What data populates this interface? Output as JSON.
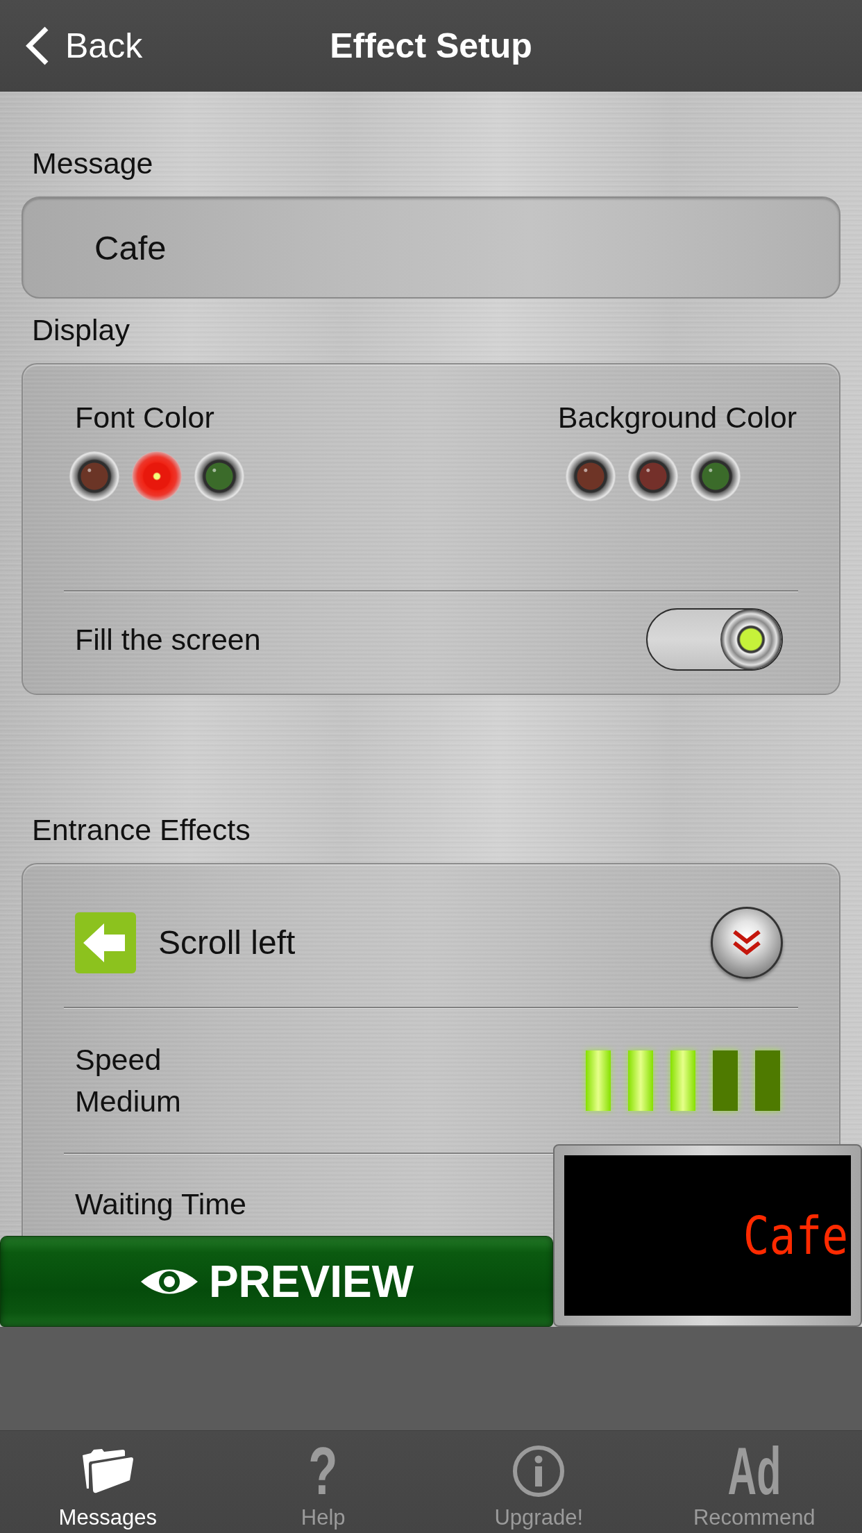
{
  "nav_bar": {
    "back": "Back",
    "title": "Effect Setup"
  },
  "message": {
    "label": "Message",
    "value": "Cafe"
  },
  "display": {
    "label": "Display",
    "font_color": {
      "label": "Font Color",
      "options": [
        {
          "color": "#6b3526",
          "selected": false
        },
        {
          "color": "#e8180c",
          "selected": true
        },
        {
          "color": "#3b6b2a",
          "selected": false
        }
      ]
    },
    "background_color": {
      "label": "Background Color",
      "options": [
        {
          "color": "#6e3426",
          "selected": false
        },
        {
          "color": "#74302a",
          "selected": false
        },
        {
          "color": "#3b6b2a",
          "selected": false
        }
      ]
    },
    "fill_screen": {
      "label": "Fill the screen",
      "on": true
    }
  },
  "entrance_effects": {
    "label": "Entrance Effects",
    "effect": "Scroll left",
    "speed": {
      "label": "Speed",
      "value": "Medium",
      "level": 0.6
    },
    "waiting_time": {
      "label": "Waiting Time"
    }
  },
  "preview": {
    "button": "PREVIEW",
    "display_text": "Cafe"
  },
  "tab_bar": [
    {
      "kind": "folder",
      "label": "Messages",
      "selected": true
    },
    {
      "kind": "glyph",
      "glyph": "?",
      "label": "Help",
      "selected": false
    },
    {
      "kind": "info",
      "label": "Upgrade!",
      "selected": false
    },
    {
      "kind": "glyph",
      "glyph": "Ad",
      "label": "Recommend",
      "selected": false
    }
  ]
}
